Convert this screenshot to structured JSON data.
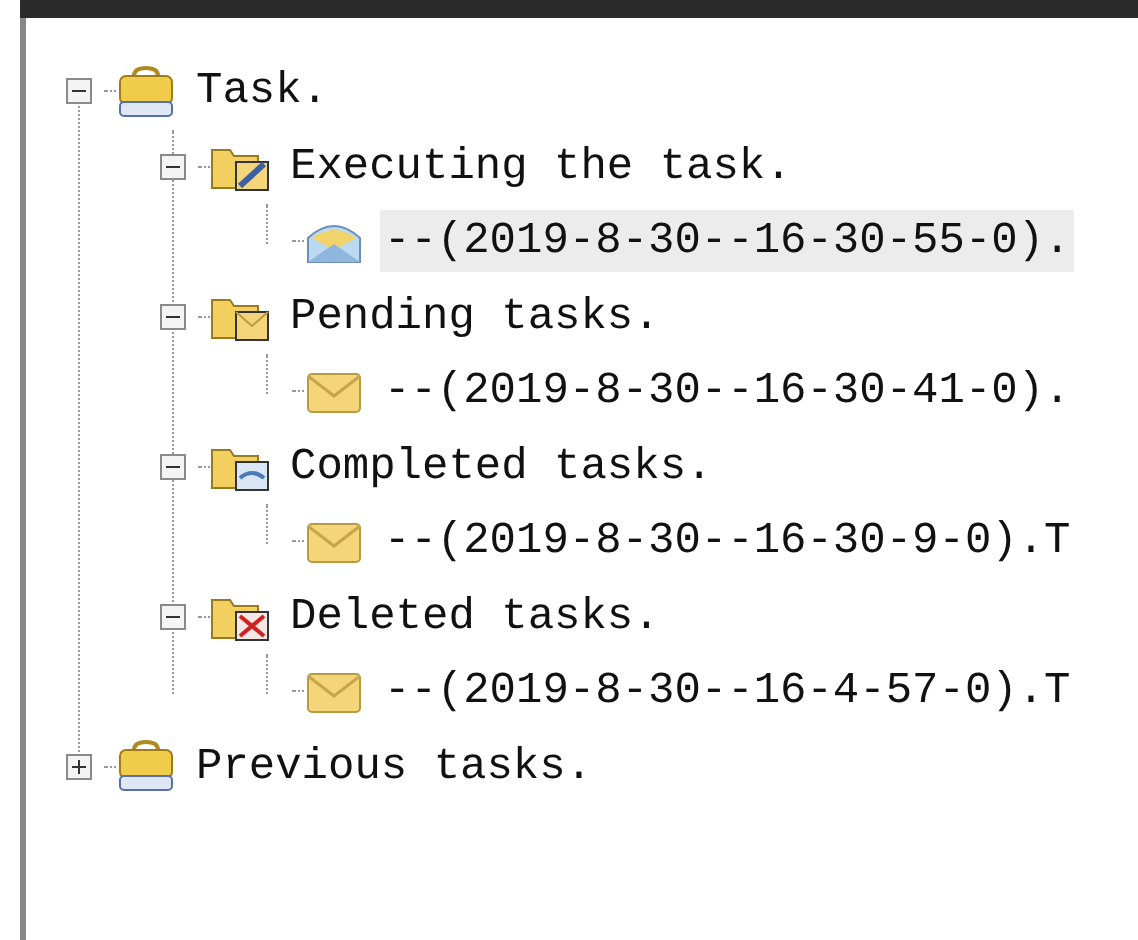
{
  "tree": [
    {
      "label": "Task.",
      "kind": "briefcase",
      "expanded": true,
      "selected": false,
      "children": [
        {
          "label": "Executing the task.",
          "kind": "folder-edit",
          "expanded": true,
          "selected": false,
          "children": [
            {
              "label": "--(2019-8-30--16-30-55-0).",
              "kind": "mail-open",
              "selected": true
            }
          ]
        },
        {
          "label": "Pending tasks.",
          "kind": "folder-mail",
          "expanded": true,
          "selected": false,
          "children": [
            {
              "label": "--(2019-8-30--16-30-41-0).",
              "kind": "mail",
              "selected": false
            }
          ]
        },
        {
          "label": "Completed tasks.",
          "kind": "folder-done",
          "expanded": true,
          "selected": false,
          "children": [
            {
              "label": "--(2019-8-30--16-30-9-0).T",
              "kind": "mail",
              "selected": false
            }
          ]
        },
        {
          "label": "Deleted tasks.",
          "kind": "folder-deleted",
          "expanded": true,
          "selected": false,
          "children": [
            {
              "label": "--(2019-8-30--16-4-57-0).T",
              "kind": "mail",
              "selected": false
            }
          ]
        }
      ]
    },
    {
      "label": "Previous tasks.",
      "kind": "briefcase",
      "expanded": false,
      "selected": false
    }
  ]
}
